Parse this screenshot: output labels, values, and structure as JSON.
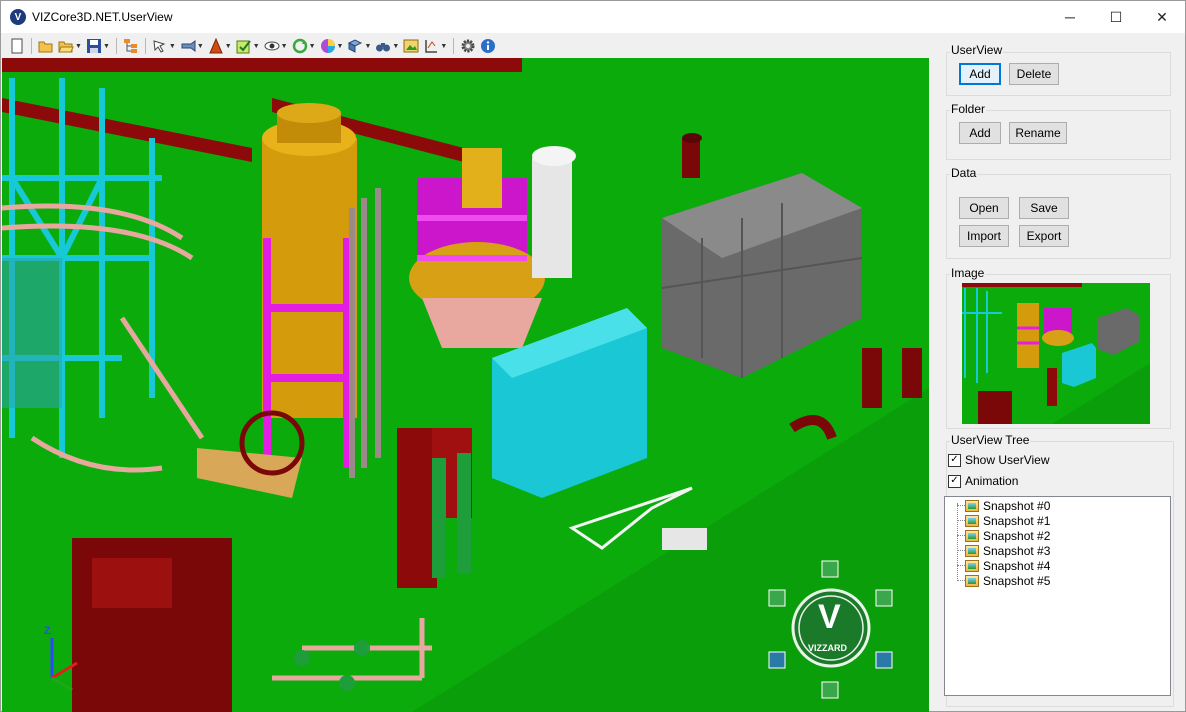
{
  "window": {
    "title": "VIZCore3D.NET.UserView",
    "app_icon_letter": "V",
    "controls": {
      "minimize": "─",
      "maximize": "☐",
      "close": "✕"
    }
  },
  "toolbar": {
    "icons": [
      "new-icon",
      "open-folder-icon",
      "open-folder-dropdown-icon",
      "save-icon",
      "tree-icon",
      "select-icon",
      "camera-icon",
      "render-mode-icon",
      "color-icon",
      "visibility-icon",
      "rotate-icon",
      "material-icon",
      "clipping-icon",
      "binoculars-icon",
      "image-icon",
      "measure-icon",
      "settings-icon",
      "info-icon"
    ]
  },
  "viewport": {
    "logo_text": "VIZZARD",
    "logo_letter": "V",
    "axis_label": "Z",
    "colors": {
      "background": "#0bab0b",
      "accent": "#e21ee2",
      "gold": "#d4a20a",
      "cyan": "#17c9d6",
      "maroon": "#8c0a0a"
    }
  },
  "panel": {
    "userview": {
      "title": "UserView",
      "add": "Add",
      "delete": "Delete"
    },
    "folder": {
      "title": "Folder",
      "add": "Add",
      "rename": "Rename"
    },
    "data": {
      "title": "Data",
      "open": "Open",
      "save": "Save",
      "import": "Import",
      "export": "Export"
    },
    "image": {
      "title": "Image"
    },
    "tree": {
      "title": "UserView Tree",
      "show_userview": "Show UserView",
      "animation": "Animation",
      "show_userview_checked": true,
      "animation_checked": true,
      "items": [
        "Snapshot #0",
        "Snapshot #1",
        "Snapshot #2",
        "Snapshot #3",
        "Snapshot #4",
        "Snapshot #5"
      ]
    }
  }
}
